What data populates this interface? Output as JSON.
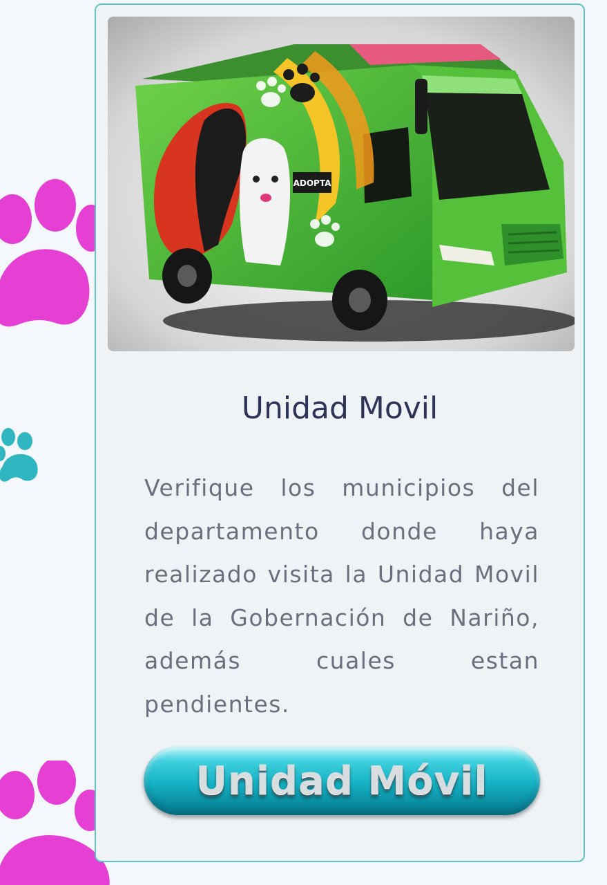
{
  "card": {
    "title": "Unidad Movil",
    "description": "Verifique los municipios del departamento donde haya realizado visita la Unidad Movil de la Gobernación de Nariño, además cuales estan pendientes.",
    "button_label": "Unidad Móvil"
  },
  "photo": {
    "bus_sign": "ADOPTA"
  },
  "colors": {
    "accent_teal": "#21b9c9",
    "paw_magenta": "#e63fd4",
    "paw_teal": "#2fb6c0",
    "title_navy": "#2e3358",
    "text_gray": "#6a6f7e"
  },
  "icons": [
    "paw-icon"
  ]
}
